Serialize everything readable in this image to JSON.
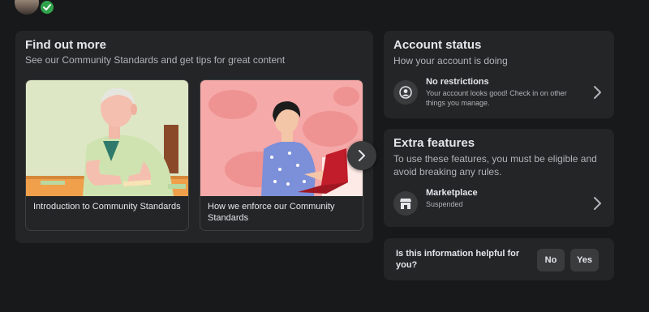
{
  "find_out_more": {
    "title": "Find out more",
    "subtitle": "See our Community Standards and get tips for great content",
    "tiles": [
      {
        "caption": "Introduction to Community Standards"
      },
      {
        "caption": "How we enforce our Community Standards"
      }
    ],
    "next_icon": "chevron-right-icon"
  },
  "account_status": {
    "title": "Account status",
    "subtitle": "How your account is doing",
    "item": {
      "title": "No restrictions",
      "description": "Your account looks good! Check in on other things you manage.",
      "icon": "user-circle-icon"
    }
  },
  "extra_features": {
    "title": "Extra features",
    "subtitle": "To use these features, you must be eligible and avoid breaking any rules.",
    "item": {
      "title": "Marketplace",
      "description": "Suspended",
      "icon": "store-icon"
    }
  },
  "helpful": {
    "question": "Is this information helpful for you?",
    "no_label": "No",
    "yes_label": "Yes"
  },
  "colors": {
    "background": "#18191a",
    "card": "#242526",
    "button": "#3a3b3c",
    "verified_badge": "#31a24c"
  }
}
